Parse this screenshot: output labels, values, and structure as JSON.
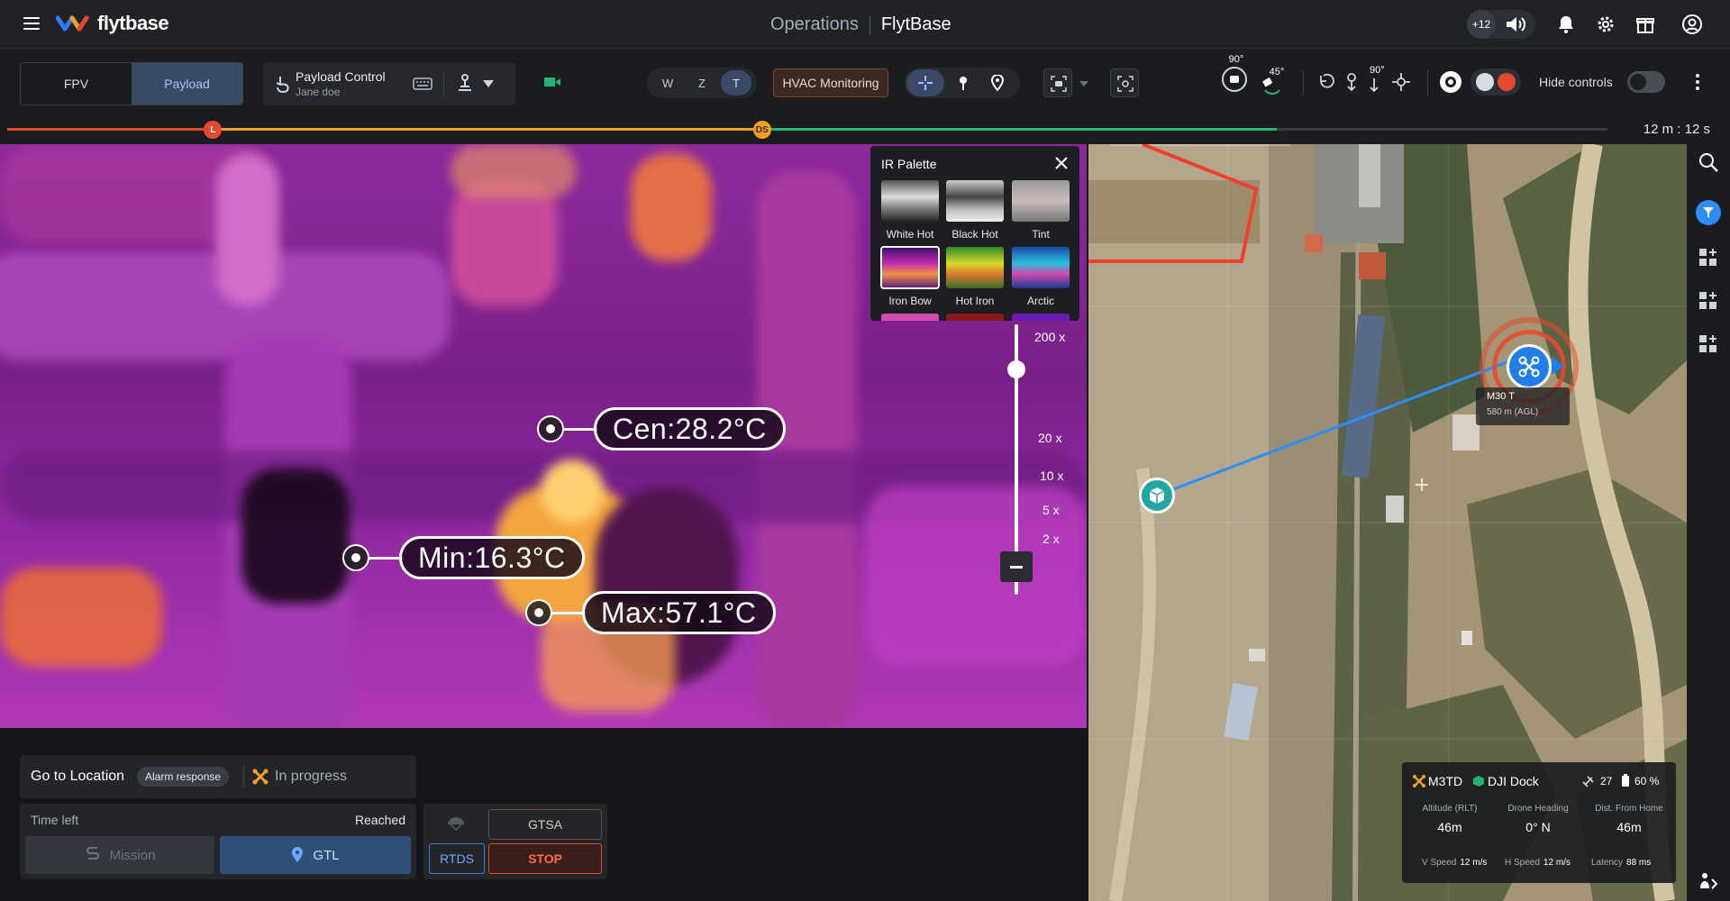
{
  "app": {
    "brand": "flytbase",
    "section": "Operations",
    "org": "FlytBase",
    "notification_count": "+12"
  },
  "controls": {
    "view_tabs": [
      {
        "label": "FPV",
        "active": false
      },
      {
        "label": "Payload",
        "active": true
      }
    ],
    "payload": {
      "title": "Payload Control",
      "user": "Jane doe"
    },
    "zoom_modes": [
      {
        "label": "W"
      },
      {
        "label": "Z"
      },
      {
        "label": "T",
        "active": true
      }
    ],
    "mission_tag": "HVAC Monitoring",
    "gimbal_pitch": "90°",
    "gimbal_yaw": "45°",
    "gimbal_angle_2": "90°",
    "hide_controls_label": "Hide controls",
    "hide_controls_on": false
  },
  "timeline": {
    "marker_l": "L",
    "marker_ds": "DS",
    "elapsed": "12 m : 12 s",
    "progress_to_l": 0.12,
    "progress_to_ds": 0.44,
    "progress_green_end": 0.74
  },
  "camera": {
    "center_temp": "Cen:28.2°C",
    "min_temp": "Min:16.3°C",
    "max_temp": "Max:57.1°C",
    "zoom_levels": [
      "200 x",
      "20 x",
      "10 x",
      "5 x",
      "2 x"
    ]
  },
  "ir_palette": {
    "title": "IR Palette",
    "options": [
      {
        "label": "White Hot"
      },
      {
        "label": "Black Hot"
      },
      {
        "label": "Tint"
      },
      {
        "label": "Iron Bow",
        "selected": true
      },
      {
        "label": "Hot Iron"
      },
      {
        "label": "Arctic"
      }
    ]
  },
  "task": {
    "title": "Go to Location",
    "badge": "Alarm response",
    "status": "In progress",
    "time_left_label": "Time left",
    "time_left_value": "Reached",
    "mission_button": "Mission",
    "gtl_button": "GTL",
    "gtsa_button": "GTSA",
    "rtds_button": "RTDS",
    "stop_button": "STOP"
  },
  "map": {
    "drone_label": "M30 T",
    "drone_alt": "580 m (AGL)"
  },
  "telemetry": {
    "drone": "M3TD",
    "dock": "DJI Dock",
    "satellites": "27",
    "battery": "60 %",
    "altitude_label": "Altitude (RLT)",
    "altitude_value": "46m",
    "heading_label": "Drone Heading",
    "heading_value": "0° N",
    "dist_label": "Dist. From Home",
    "dist_value": "46m",
    "vspeed_label": "V Speed",
    "vspeed_value": "12 m/s",
    "hspeed_label": "H Speed",
    "hspeed_value": "12 m/s",
    "latency_label": "Latency",
    "latency_value": "88 ms"
  },
  "colors": {
    "accent": "#3b7dde",
    "warn": "#f0a020",
    "danger": "#e64a2e",
    "ok": "#22b573"
  }
}
